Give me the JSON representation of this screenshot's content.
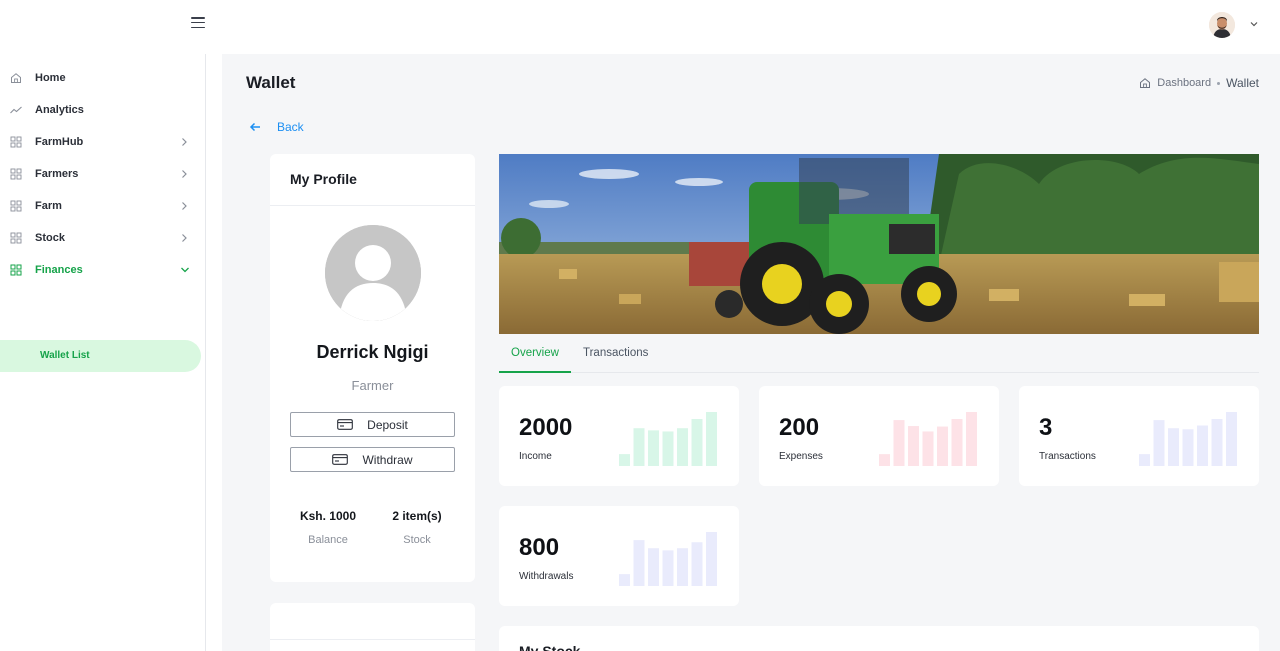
{
  "header": {
    "menu_icon": "hamburger-icon",
    "avatar_icon": "user-avatar",
    "caret_icon": "chevron-down-icon"
  },
  "sidebar": {
    "items": [
      {
        "label": "Home",
        "icon": "home-icon",
        "has_children": false
      },
      {
        "label": "Analytics",
        "icon": "trend-icon",
        "has_children": false
      },
      {
        "label": "FarmHub",
        "icon": "grid-icon",
        "has_children": true
      },
      {
        "label": "Farmers",
        "icon": "grid-icon",
        "has_children": true
      },
      {
        "label": "Farm",
        "icon": "grid-icon",
        "has_children": true
      },
      {
        "label": "Stock",
        "icon": "grid-icon",
        "has_children": true
      },
      {
        "label": "Finances",
        "icon": "grid-icon",
        "has_children": true,
        "expanded": true
      }
    ],
    "sub_items": [
      {
        "label": "Wallet List"
      }
    ],
    "active_color": "#16a34a"
  },
  "page": {
    "title": "Wallet",
    "breadcrumb": {
      "home": "Dashboard",
      "current": "Wallet"
    },
    "back_label": "Back"
  },
  "profile": {
    "heading": "My Profile",
    "name": "Derrick Ngigi",
    "role": "Farmer",
    "deposit_label": "Deposit",
    "withdraw_label": "Withdraw",
    "balance_value": "Ksh. 1000",
    "balance_label": "Balance",
    "stock_value": "2 item(s)",
    "stock_label": "Stock"
  },
  "tabs": [
    {
      "label": "Overview",
      "active": true
    },
    {
      "label": "Transactions",
      "active": false
    }
  ],
  "stats": [
    {
      "value": "2000",
      "label": "Income",
      "color": "#d8f6e8",
      "bars": [
        0.22,
        0.7,
        0.66,
        0.64,
        0.7,
        0.87,
        1.0
      ]
    },
    {
      "value": "200",
      "label": "Expenses",
      "color": "#fde2e7",
      "bars": [
        0.22,
        0.85,
        0.74,
        0.64,
        0.73,
        0.87,
        1.0
      ]
    },
    {
      "value": "3",
      "label": "Transactions",
      "color": "#e9ebfc",
      "bars": [
        0.22,
        0.85,
        0.7,
        0.68,
        0.75,
        0.87,
        1.0
      ]
    },
    {
      "value": "800",
      "label": "Withdrawals",
      "color": "#e9ebfc",
      "bars": [
        0.22,
        0.85,
        0.7,
        0.66,
        0.7,
        0.81,
        1.0
      ]
    }
  ],
  "stock_section": {
    "title": "My Stock"
  }
}
